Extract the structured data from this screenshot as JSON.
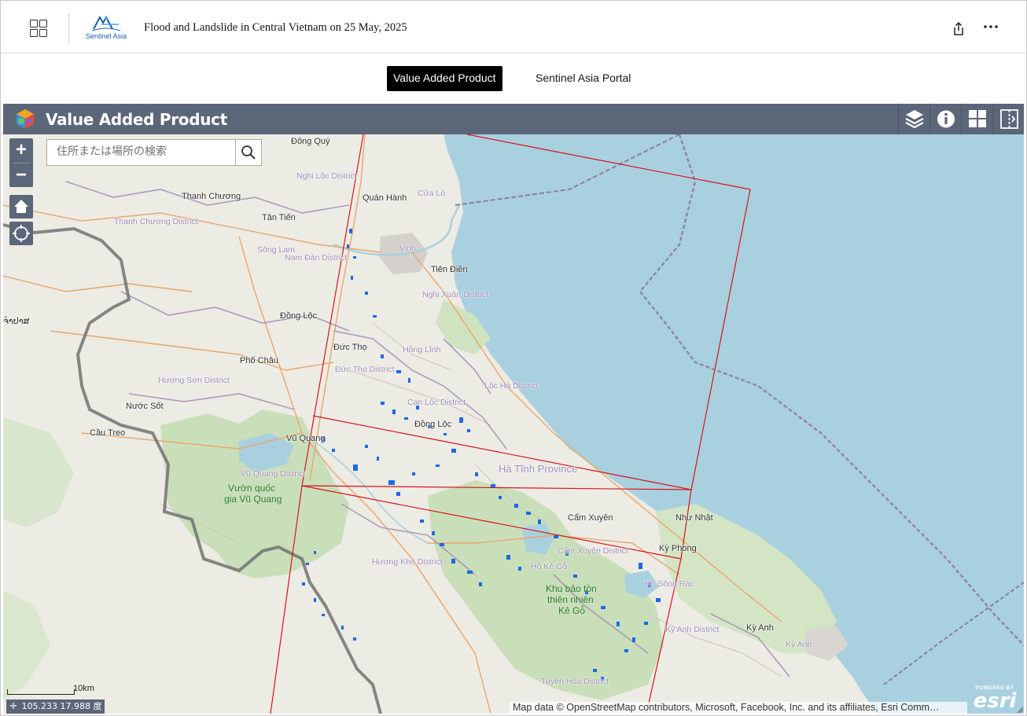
{
  "header": {
    "title": "Flood and Landslide in Central Vietnam on 25 May, 2025",
    "logo_text": "Sentinel Asia",
    "icons": {
      "apps": "apps-grid-icon",
      "share": "share-icon",
      "more": "more-horizontal-icon"
    }
  },
  "tabs": [
    {
      "label": "Value Added Product",
      "active": true
    },
    {
      "label": "Sentinel Asia Portal",
      "active": false
    }
  ],
  "map_app": {
    "title": "Value Added Product",
    "tools": [
      "layers-icon",
      "info-icon",
      "basemap-gallery-icon",
      "split-view-icon"
    ]
  },
  "map": {
    "search_placeholder": "住所または場所の検索",
    "zoom_in": "+",
    "zoom_out": "−",
    "coordinates": "105.233 17.988 度",
    "scale_label": "10km",
    "attribution": "Map data © OpenStreetMap contributors, Microsoft, Facebook, Inc. and its affiliates, Esri Comm…",
    "esri_powered": "POWERED BY",
    "esri_name": "esri",
    "labels": {
      "dong_quy": "Đông Quý",
      "nghi_loc": "Nghi Lộc District",
      "thanh_chuong": "Thanh Chương",
      "quan_hanh": "Quán Hành",
      "cua_lo": "Cửa Lò",
      "tan_tien": "Tân Tiến",
      "thanh_chuong_d": "Thanh Chương District",
      "song_lam": "Sông Lam",
      "vinh": "Vinh",
      "nam_dan": "Nam Đàn District",
      "tien_dien": "Tiên Điền",
      "nghi_xuan": "Nghi Xuân District",
      "laos": "ຈຳປາສ",
      "dong_loc_n": "Đồng Lộc",
      "duc_tho": "Đức Thọ",
      "hong_linh": "Hồng Lĩnh",
      "pho_chau": "Phố Châu",
      "duc_tho_d": "Đức Thọ District",
      "huong_son": "Hương Sơn District",
      "loc_ha": "Lộc Hà District",
      "nuoc_sot": "Nước Sốt",
      "can_loc": "Can Lộc District",
      "dong_loc": "Đồng Lộc",
      "cau_treo": "Cầu Treo",
      "vu_quang": "Vũ Quang",
      "ha_tinh": "Hà Tĩnh Province",
      "vu_quang_d": "Vũ Quang District",
      "vuon_quoc": "Vườn quốc",
      "gia_vu_quang": "gia Vũ Quang",
      "cam_xuyen": "Cẩm Xuyên",
      "nhu_nhat": "Như Nhật",
      "ky_phong": "Kỳ Phong",
      "cam_xuyen_d": "Cẩm Xuyên District",
      "huong_khe": "Hương Khê District",
      "ho_ke_go": "Hồ Kẻ Gỗ",
      "ho_song_rac": "Hồ Sông Rác",
      "khu_bao_ton": "Khu bảo tồn",
      "thien_nhien": "thiên nhiên",
      "ke_go": "Kẻ Gỗ",
      "ky_anh_d": "Kỳ Anh District",
      "ky_anh": "Kỳ Anh",
      "ky_anh_2": "Kỳ Anh",
      "tuyen_hoa": "Tuyên Hóa District"
    },
    "colors": {
      "sea": "#a9d0df",
      "land": "#ecebe4",
      "forest": "#c9dfb9",
      "footprint": "#d9141b",
      "flood": "#1b6ae6",
      "boundary": "#8c7e9e",
      "toolbar": "#5c6679"
    }
  }
}
